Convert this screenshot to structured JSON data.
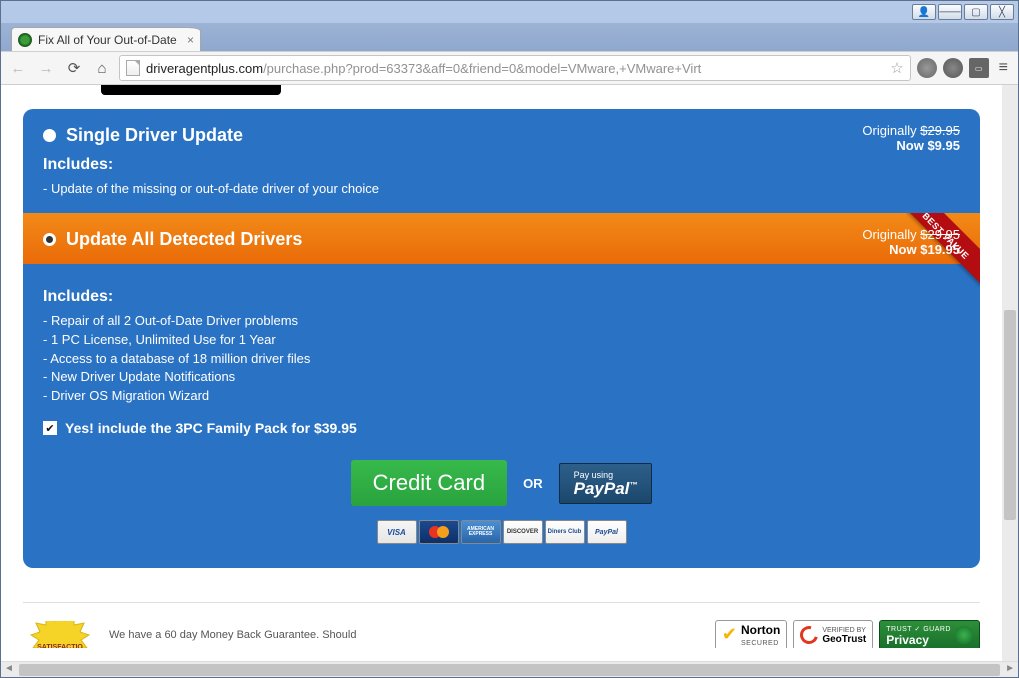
{
  "window": {
    "btn_profile": "👤",
    "btn_min": "───",
    "btn_max": "▢",
    "btn_close": "╳"
  },
  "tab": {
    "title": "Fix All of Your Out-of-Date"
  },
  "toolbar": {
    "url_domain": "driveragentplus.com",
    "url_path": "/purchase.php?prod=63373&aff=0&friend=0&model=VMware,+VMware+Virt"
  },
  "option1": {
    "title": "Single Driver Update",
    "originally_label": "Originally",
    "originally_price": "$29.95",
    "now_label": "Now",
    "now_price": "$9.95",
    "includes_header": "Includes:",
    "features": [
      "- Update of the missing or out-of-date driver of your choice"
    ]
  },
  "option2": {
    "title": "Update All Detected Drivers",
    "ribbon": "BEST VALUE",
    "originally_label": "Originally",
    "originally_price": "$29.95",
    "now_label": "Now",
    "now_price": "$19.95",
    "includes_header": "Includes:",
    "features": [
      "- Repair of all 2 Out-of-Date Driver problems",
      "- 1 PC License, Unlimited Use for 1 Year",
      "- Access to a database of 18 million driver files",
      "- New Driver Update Notifications",
      "- Driver OS Migration Wizard"
    ]
  },
  "family_pack": {
    "label": "Yes! include the 3PC Family Pack for $39.95"
  },
  "pay": {
    "cc": "Credit Card",
    "or": "OR",
    "pp_small": "Pay using",
    "pp_large": "PayPal"
  },
  "cards": {
    "visa": "VISA",
    "amex": "AMERICAN EXPRESS",
    "disc": "DISCOVER",
    "diners": "Diners Club",
    "ppal": "PayPal"
  },
  "footer": {
    "satisfaction": "SATISFACTIO",
    "guarantee": "We have a 60 day Money Back Guarantee. Should",
    "norton_name": "Norton",
    "norton_sub": "SECURED",
    "geo_top": "VERIFIED BY",
    "geo_name": "GeoTrust",
    "priv_top": "TRUST ✓ GUARD",
    "priv_name": "Privacy"
  }
}
